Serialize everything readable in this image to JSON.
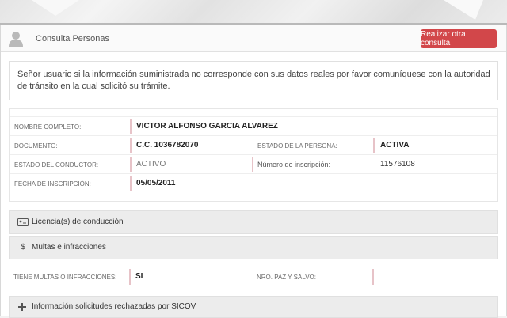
{
  "header": {
    "title": "Consulta Personas",
    "new_query_button": "Realizar otra consulta"
  },
  "notice": {
    "text": "Señor usuario si la información suministrada no corresponde con sus datos reales por favor comuníquese con la autoridad de tránsito en la cual solicitó su trámite."
  },
  "person": {
    "nombre_label": "NOMBRE COMPLETO:",
    "nombre_value": "VICTOR ALFONSO GARCIA ALVAREZ",
    "documento_label": "DOCUMENTO:",
    "documento_value": "C.C. 1036782070",
    "estado_persona_label": "ESTADO DE LA PERSONA:",
    "estado_persona_value": "ACTIVA",
    "estado_conductor_label": "ESTADO DEL CONDUCTOR:",
    "estado_conductor_value": "ACTIVO",
    "numero_inscripcion_label": "Número de inscripción:",
    "numero_inscripcion_value": "11576108",
    "fecha_inscripcion_label": "FECHA DE INSCRIPCIÓN:",
    "fecha_inscripcion_value": "05/05/2011"
  },
  "sections": {
    "licencias": "Licencia(s) de conducción",
    "multas": "Multas e infracciones",
    "rechazadas": "Información solicitudes rechazadas por SICOV"
  },
  "multas": {
    "tiene_label": "TIENE MULTAS O INFRACCIONES:",
    "tiene_value": "SI",
    "paz_salvo_label": "NRO. PAZ Y SALVO:",
    "paz_salvo_value": ""
  },
  "colors": {
    "button_bg": "#d2474a",
    "separator": "#e7c3c8"
  },
  "icons": {
    "user": "user-icon",
    "license": "id-card-icon",
    "money": "dollar-icon",
    "plus": "plus-icon"
  }
}
